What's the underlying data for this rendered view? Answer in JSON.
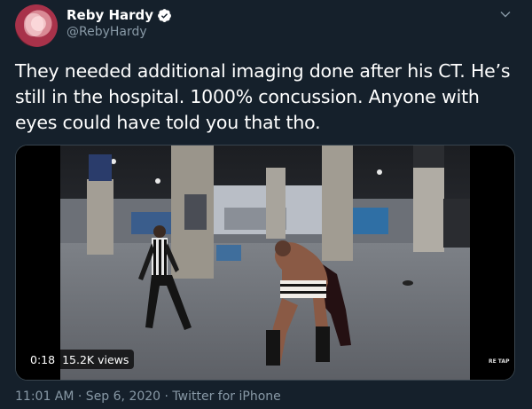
{
  "author": {
    "display_name": "Reby Hardy",
    "handle": "@RebyHardy"
  },
  "tweet": {
    "text": "They needed additional imaging done after his CT. He’s still in the hospital. 1000% concussion. Anyone with eyes could have told you that tho."
  },
  "video": {
    "elapsed": "0:18",
    "views": "15.2K views",
    "watermark": "RE TAP"
  },
  "meta": {
    "timestamp": "11:01 AM · Sep 6, 2020 · Twitter for iPhone"
  },
  "icons": {
    "verified": "verified-badge-icon",
    "menu": "chevron-down-icon"
  },
  "colors": {
    "background": "#15202b",
    "secondary_text": "#8899a6",
    "verified": "#ffffff"
  }
}
